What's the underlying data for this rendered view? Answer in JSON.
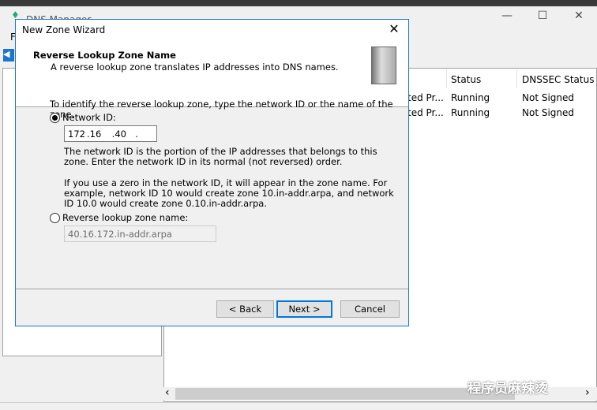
{
  "main_window": {
    "title": "DNS Manager",
    "menu_first": "F",
    "minimize": "—",
    "maximize": "☐",
    "close": "✕",
    "columns": [
      "Status",
      "DNSSEC Status"
    ],
    "rows": [
      {
        "type": "ted Pr...",
        "status": "Running",
        "dnssec": "Not Signed"
      },
      {
        "type": "ted Pr...",
        "status": "Running",
        "dnssec": "Not Signed"
      }
    ],
    "scroll_left": "‹",
    "scroll_right": "›"
  },
  "dialog": {
    "title": "New Zone Wizard",
    "close": "✕",
    "header_title": "Reverse Lookup Zone Name",
    "header_subtitle": "A reverse lookup zone translates IP addresses into DNS names.",
    "intro": "To identify the reverse lookup zone, type the network ID or the name of the zone.",
    "network_id_label": "Network ID:",
    "network_id_selected": true,
    "network_id_octets": [
      "172",
      "16",
      "40",
      ""
    ],
    "help1": "The network ID is the portion of the IP addresses that belongs to this zone. Enter the network ID in its normal (not reversed) order.",
    "help2": "If you use a zero in the network ID, it will appear in the zone name. For example, network ID 10 would create zone 10.in-addr.arpa, and network ID 10.0 would create zone 0.10.in-addr.arpa.",
    "zone_name_label": "Reverse lookup zone name:",
    "zone_name_value": "40.16.172.in-addr.arpa",
    "back": "< Back",
    "next": "Next >",
    "cancel": "Cancel"
  },
  "watermark": "程序员麻辣烫",
  "colors": {
    "accent": "#0078d7",
    "dialog_border": "#1979ca"
  }
}
